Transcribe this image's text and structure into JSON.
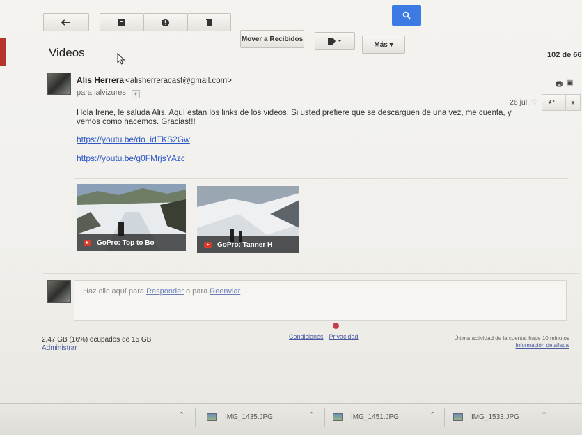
{
  "toolbar": {
    "more_label": "Más ▾",
    "move_inbox_label": "Mover a Recibidos"
  },
  "message_count": "102 de 66",
  "email": {
    "subject": "Videos",
    "sender_name": "Alis Herrera",
    "sender_email": "<alisherreracast@gmail.com>",
    "recipient": "para ialvizures",
    "date": "26 jul.",
    "body": "Hola Irene, le saluda Alis. Aquí están los links de los videos. Si usted prefiere que se descarguen de una vez, me cuenta, y vemos como hacemos. Gracias!!!",
    "links": [
      "https://youtu.be/do_idTKS2Gw",
      "https://youtu.be/g0FMrjsYAzc"
    ],
    "videos": [
      {
        "title": "GoPro: Top to Bo"
      },
      {
        "title": "GoPro: Tanner H"
      }
    ]
  },
  "reply": {
    "prefix": "Haz clic aquí para ",
    "reply_link": "Responder",
    "middle": " o para ",
    "forward_link": "Reenviar"
  },
  "footer": {
    "storage": "2,47 GB (16%) ocupados de 15 GB",
    "manage": "Administrar",
    "terms": "Condiciones",
    "dash": " - ",
    "privacy": "Privacidad",
    "last_activity": "Última actividad de la cuenta: hace 10 minutos",
    "details": "Información detallada"
  },
  "downloads": [
    "IMG_1435.JPG",
    "IMG_1451.JPG",
    "IMG_1533.JPG"
  ]
}
